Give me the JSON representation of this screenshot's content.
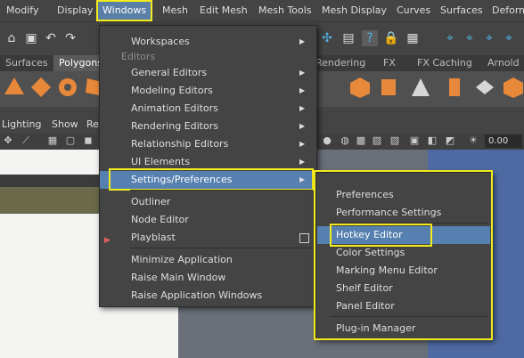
{
  "menubar": {
    "items": [
      "Modify",
      "Display",
      "Windows",
      "Mesh",
      "Edit Mesh",
      "Mesh Tools",
      "Mesh Display",
      "Curves",
      "Surfaces",
      "Deform"
    ]
  },
  "shelf_tabs": [
    "Surfaces",
    "Polygons",
    "Rendering",
    "FX",
    "FX Caching",
    "Arnold"
  ],
  "panel_menu": [
    "Lighting",
    "Show",
    "Re"
  ],
  "zoom_value": "0.00",
  "windows_menu": {
    "workspaces": "Workspaces",
    "editors_header": "Editors",
    "general_editors": "General Editors",
    "modeling_editors": "Modeling Editors",
    "animation_editors": "Animation Editors",
    "rendering_editors": "Rendering Editors",
    "relationship_editors": "Relationship Editors",
    "ui_elements": "UI Elements",
    "settings_preferences": "Settings/Preferences",
    "outliner": "Outliner",
    "node_editor": "Node Editor",
    "playblast": "Playblast",
    "minimize_application": "Minimize Application",
    "raise_main_window": "Raise Main Window",
    "raise_application_windows": "Raise Application Windows"
  },
  "settings_submenu": {
    "preferences": "Preferences",
    "performance_settings": "Performance Settings",
    "hotkey_editor": "Hotkey Editor",
    "color_settings": "Color Settings",
    "marking_menu_editor": "Marking Menu Editor",
    "shelf_editor": "Shelf Editor",
    "panel_editor": "Panel Editor",
    "plugin_manager": "Plug-in Manager"
  },
  "colors": {
    "highlight": "#5580b0",
    "callout": "#f2ea1b",
    "menu_bg": "#444444"
  }
}
